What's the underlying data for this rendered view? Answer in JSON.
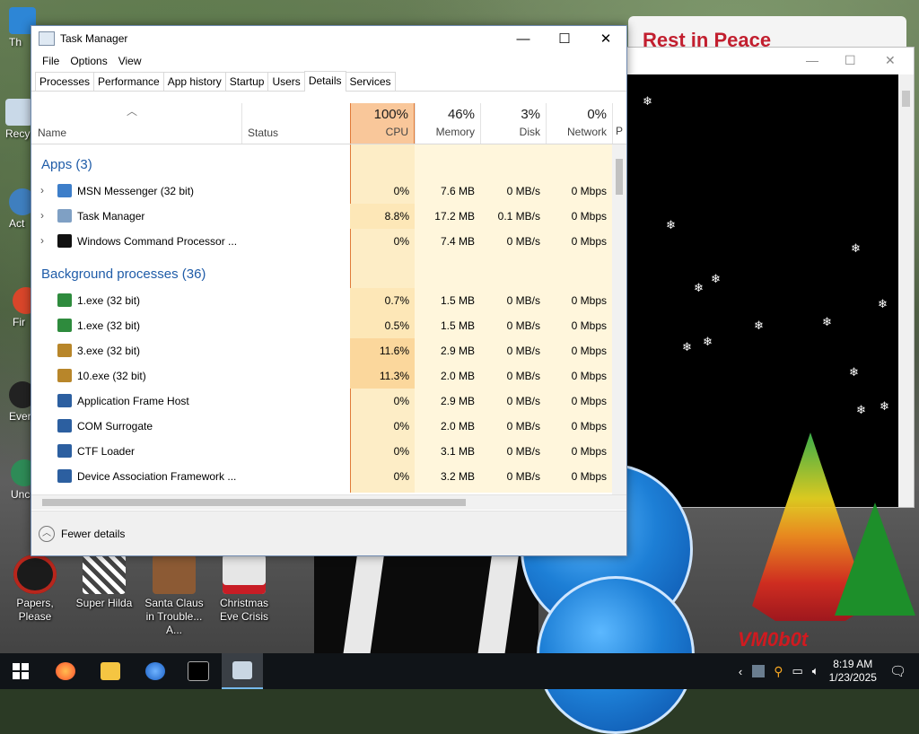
{
  "window": {
    "title": "Task Manager",
    "controls": {
      "minimize": "—",
      "maximize": "☐",
      "close": "✕"
    }
  },
  "menu": [
    "File",
    "Options",
    "View"
  ],
  "tabs": [
    "Processes",
    "Performance",
    "App history",
    "Startup",
    "Users",
    "Details",
    "Services"
  ],
  "active_tab": "Details",
  "columns": {
    "name": "Name",
    "status": "Status",
    "cpu": {
      "percent": "100%",
      "label": "CPU"
    },
    "memory": {
      "percent": "46%",
      "label": "Memory"
    },
    "disk": {
      "percent": "3%",
      "label": "Disk"
    },
    "network": {
      "percent": "0%",
      "label": "Network"
    },
    "power_partial": "P"
  },
  "groups": {
    "apps": "Apps (3)",
    "background": "Background processes (36)"
  },
  "apps": [
    {
      "name": "MSN Messenger (32 bit)",
      "cpu": "0%",
      "memory": "7.6 MB",
      "disk": "0 MB/s",
      "network": "0 Mbps"
    },
    {
      "name": "Task Manager",
      "cpu": "8.8%",
      "memory": "17.2 MB",
      "disk": "0.1 MB/s",
      "network": "0 Mbps"
    },
    {
      "name": "Windows Command Processor ...",
      "cpu": "0%",
      "memory": "7.4 MB",
      "disk": "0 MB/s",
      "network": "0 Mbps"
    }
  ],
  "background": [
    {
      "name": "1.exe (32 bit)",
      "cpu": "0.7%",
      "memory": "1.5 MB",
      "disk": "0 MB/s",
      "network": "0 Mbps"
    },
    {
      "name": "1.exe (32 bit)",
      "cpu": "0.5%",
      "memory": "1.5 MB",
      "disk": "0 MB/s",
      "network": "0 Mbps"
    },
    {
      "name": "3.exe (32 bit)",
      "cpu": "11.6%",
      "memory": "2.9 MB",
      "disk": "0 MB/s",
      "network": "0 Mbps"
    },
    {
      "name": "10.exe (32 bit)",
      "cpu": "11.3%",
      "memory": "2.0 MB",
      "disk": "0 MB/s",
      "network": "0 Mbps"
    },
    {
      "name": "Application Frame Host",
      "cpu": "0%",
      "memory": "2.9 MB",
      "disk": "0 MB/s",
      "network": "0 Mbps"
    },
    {
      "name": "COM Surrogate",
      "cpu": "0%",
      "memory": "2.0 MB",
      "disk": "0 MB/s",
      "network": "0 Mbps"
    },
    {
      "name": "CTF Loader",
      "cpu": "0%",
      "memory": "3.1 MB",
      "disk": "0 MB/s",
      "network": "0 Mbps"
    },
    {
      "name": "Device Association Framework ...",
      "cpu": "0%",
      "memory": "3.2 MB",
      "disk": "0 MB/s",
      "network": "0 Mbps"
    }
  ],
  "footer": {
    "fewer_details": "Fewer details"
  },
  "desktop_icons": [
    {
      "label": "Papers, Please"
    },
    {
      "label": "Super Hilda"
    },
    {
      "label": "Santa Claus in Trouble... A..."
    },
    {
      "label": "Christmas Eve Crisis"
    }
  ],
  "edge_labels": [
    "Th",
    "Recy",
    "Act",
    "Fir",
    "Ever",
    "Unc"
  ],
  "wallpaper_sign": "Rest in Peace",
  "watermark": "VM0b0t",
  "clock": {
    "time": "8:19 AM",
    "date": "1/23/2025"
  },
  "colors": {
    "cpu_heat_high": "#f9c79a",
    "cpu_bg_medium": "#fde9b8",
    "cpu_bg_light": "#fff4d1",
    "group_blue": "#1f5ca8",
    "taskbar": "#101418"
  }
}
